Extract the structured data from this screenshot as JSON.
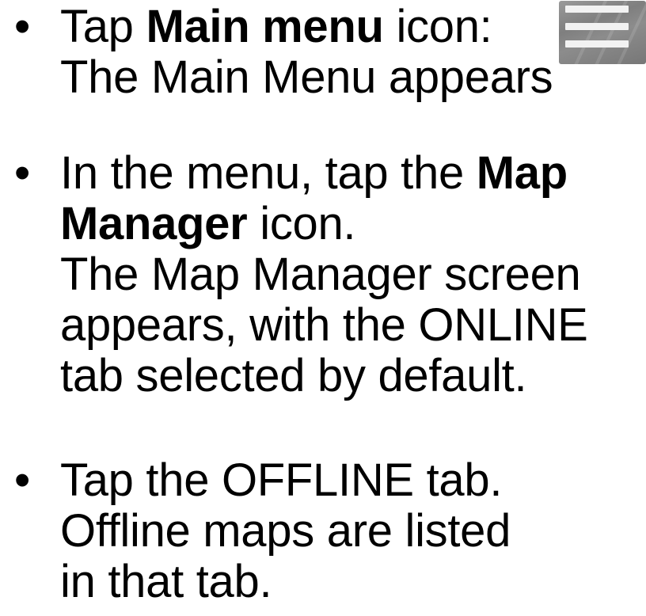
{
  "bullet_glyph": "•",
  "steps": [
    {
      "lines": [
        {
          "pre": "Tap ",
          "bold": "Main menu",
          "post": " icon:"
        },
        {
          "text": "The Main Menu appears"
        }
      ],
      "icon": "hamburger-menu-icon"
    },
    {
      "lines": [
        {
          "pre": "In the menu, tap the ",
          "bold": "Map"
        },
        {
          "bold": "Manager",
          "post": " icon."
        },
        {
          "text": "The Map Manager screen"
        },
        {
          "text": "appears, with the ONLINE"
        },
        {
          "text": "tab selected by default."
        }
      ]
    },
    {
      "lines": [
        {
          "text": "Tap the OFFLINE tab."
        },
        {
          "text": "Offline maps are listed"
        },
        {
          "text": "in that tab."
        }
      ]
    }
  ]
}
